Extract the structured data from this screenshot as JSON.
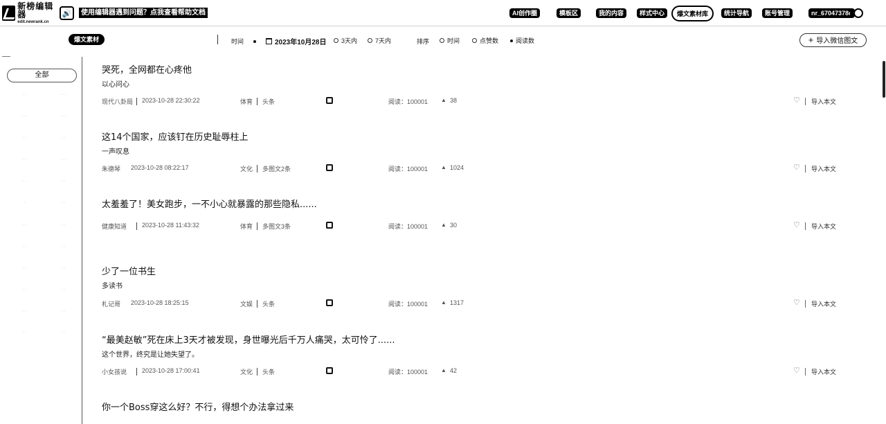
{
  "header": {
    "logo": {
      "name": "新榜编辑器",
      "url": "edit.newrank.cn"
    },
    "notice": "使用编辑器遇到问题？点我查看帮助文档",
    "nav": [
      {
        "label": "AI创作圈"
      },
      {
        "label": "模板区"
      },
      {
        "label": "我的内容"
      },
      {
        "label": "样式中心"
      },
      {
        "label": "爆文素材库",
        "active": true
      },
      {
        "label": "统计导航"
      },
      {
        "label": "账号管理"
      }
    ],
    "user": "nr_67047378c"
  },
  "filters": {
    "category_pill": "爆文素材",
    "time_label": "时间",
    "date": "2023年10月28日",
    "range_options": [
      "3天内",
      "7天内"
    ],
    "sort_label": "排序",
    "sort_options": [
      "时间",
      "点赞数",
      "阅读数"
    ],
    "import_button": "导入微信图文"
  },
  "sidebar": {
    "all_label": "全部"
  },
  "meta_labels": {
    "read_prefix": "阅读：",
    "import_label": "导入本文"
  },
  "articles": [
    {
      "title": "哭死，全网都在心疼他",
      "subtitle": "以心问心",
      "author": "现代八卦局",
      "time": "2023-10-28 22:30:22",
      "type": "体育",
      "tag": "头条",
      "reads": "100001",
      "likes": "38"
    },
    {
      "title": "这14个国家，应该钉在历史耻辱柱上",
      "subtitle": "一声叹息",
      "author": "朱德琴",
      "time": "2023-10-28 08:22:17",
      "type": "文化",
      "tag": "多图文2条",
      "reads": "100001",
      "likes": "1024"
    },
    {
      "title": "太羞羞了！美女跑步，一不小心就暴露的那些隐私......",
      "subtitle": "",
      "author": "健康知道",
      "time": "2023-10-28 11:43:32",
      "type": "体育",
      "tag": "多图文3条",
      "reads": "100001",
      "likes": "30"
    },
    {
      "title": "少了一位书生",
      "subtitle": "多读书",
      "author": "札记哥",
      "time": "2023-10-28 18:25:15",
      "type": "文娱",
      "tag": "头条",
      "reads": "100001",
      "likes": "1317"
    },
    {
      "title": "“最美赵敏”死在床上3天才被发现，身世曝光后千万人痛哭，太可怜了......",
      "subtitle": "这个世界，终究是让她失望了。",
      "author": "小女孩说",
      "time": "2023-10-28 17:00:41",
      "type": "文化",
      "tag": "头条",
      "reads": "100001",
      "likes": "42"
    },
    {
      "title": "你一个Boss穿这么好？不行，得想个办法拿过来",
      "subtitle": "",
      "author": "",
      "time": "",
      "type": "",
      "tag": "",
      "reads": "",
      "likes": ""
    }
  ]
}
